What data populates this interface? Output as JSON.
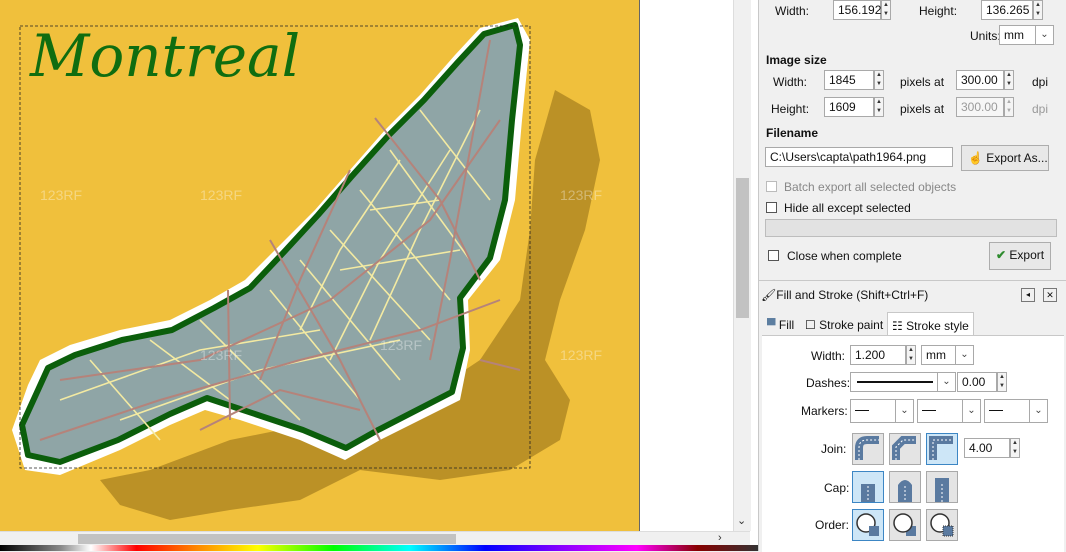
{
  "canvas": {
    "map_title": "Montreal",
    "watermark": "123RF"
  },
  "export": {
    "width_label": "Width:",
    "width_value": "156.192",
    "height_label": "Height:",
    "height_value": "136.265",
    "units_label": "Units:",
    "units_value": "mm",
    "image_size_label": "Image size",
    "img_width_label": "Width:",
    "img_width_value": "1845",
    "pixels_at_1": "pixels at",
    "dpi_x_value": "300.00",
    "dpi_1": "dpi",
    "img_height_label": "Height:",
    "img_height_value": "1609",
    "pixels_at_2": "pixels at",
    "dpi_y_value": "300.00",
    "dpi_2": "dpi",
    "filename_label": "Filename",
    "filename_value": "C:\\Users\\capta\\path1964.png",
    "export_as_label": "Export As...",
    "batch_label": "Batch export all selected objects",
    "hide_label": "Hide all except selected",
    "close_label": "Close when complete",
    "export_label": "Export"
  },
  "fill_stroke": {
    "title": "Fill and Stroke (Shift+Ctrl+F)",
    "tabs": [
      "Fill",
      "Stroke paint",
      "Stroke style"
    ],
    "width_label": "Width:",
    "width_value": "1.200",
    "width_unit": "mm",
    "dashes_label": "Dashes:",
    "dash_offset": "0.00",
    "markers_label": "Markers:",
    "join_label": "Join:",
    "miter_value": "4.00",
    "cap_label": "Cap:",
    "order_label": "Order:"
  },
  "colors": {
    "map_background": "#f0c03c",
    "island_fill": "#8fa5a6",
    "island_outline": "#0b5e0b",
    "shadow": "#b58c23",
    "title_color": "#106d10",
    "street_yellow": "#f3eaa2",
    "street_brown": "#b5837a"
  }
}
